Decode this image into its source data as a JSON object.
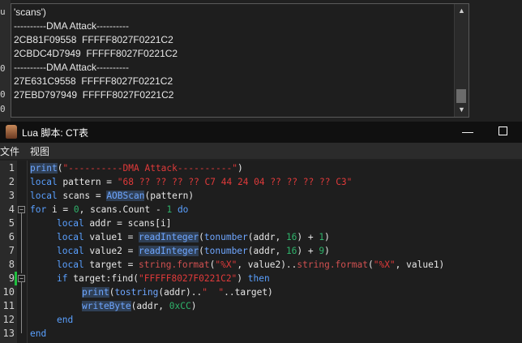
{
  "left_strip": [
    "u",
    "0",
    "0",
    "0"
  ],
  "output": {
    "lines": [
      "'scans')",
      "----------DMA Attack----------",
      "2CB81F09558  FFFFF8027F0221C2",
      "2CBDC4D7949  FFFFF8027F0221C2",
      "----------DMA Attack----------",
      "27E631C9558  FFFFF8027F0221C2",
      "27EBD797949  FFFFF8027F0221C2"
    ]
  },
  "window": {
    "title": "Lua 脚本: CT表",
    "minimize_glyph": "—"
  },
  "menu": {
    "file": "文件",
    "view": "视图"
  },
  "editor": {
    "line_numbers": [
      "1",
      "2",
      "3",
      "4",
      "5",
      "6",
      "7",
      "8",
      "9",
      "10",
      "11",
      "12",
      "13"
    ],
    "code": {
      "l1": {
        "fn": "print",
        "p1": "(",
        "str": "\"----------DMA Attack----------\"",
        "p2": ")"
      },
      "l2": {
        "kw": "local",
        "rest": " pattern = ",
        "str": "\"68 ?? ?? ?? ?? C7 44 24 04 ?? ?? ?? ?? C3\""
      },
      "l3": {
        "kw": "local",
        "rest": " scans = ",
        "fn": "AOBScan",
        "tail": "(pattern)"
      },
      "l4": {
        "kw": "for",
        "a": " i = ",
        "n0": "0",
        "b": ", scans.Count - ",
        "n1": "1",
        "c": " ",
        "kw2": "do"
      },
      "l5": {
        "kw": "local",
        "rest": " addr = scans[i]"
      },
      "l6": {
        "kw": "local",
        "a": " value1 = ",
        "fn": "readInteger",
        "b": "(",
        "fn2": "tonumber",
        "c": "(addr, ",
        "n1": "16",
        "d": ") + ",
        "n2": "1",
        "e": ")"
      },
      "l7": {
        "kw": "local",
        "a": " value2 = ",
        "fn": "readInteger",
        "b": "(",
        "fn2": "tonumber",
        "c": "(addr, ",
        "n1": "16",
        "d": ") + ",
        "n2": "9",
        "e": ")"
      },
      "l8": {
        "kw": "local",
        "a": " target = ",
        "fn": "string.format",
        "b": "(",
        "str": "\"%X\"",
        "c": ", value2)..",
        "fn2": "string.format",
        "d": "(",
        "str2": "\"%X\"",
        "e": ", value1)"
      },
      "l9": {
        "kw": "if",
        "a": " target:find(",
        "str": "\"FFFFF8027F0221C2\"",
        "b": ") ",
        "kw2": "then"
      },
      "l10": {
        "fn": "print",
        "a": "(",
        "fn2": "tostring",
        "b": "(addr)..",
        "str": "\"  \"",
        "c": "..target)"
      },
      "l11": {
        "fn": "writeByte",
        "a": "(addr, ",
        "n": "0xCC",
        "b": ")"
      },
      "l12": {
        "kw": "end"
      },
      "l13": {
        "kw": "end"
      }
    }
  }
}
